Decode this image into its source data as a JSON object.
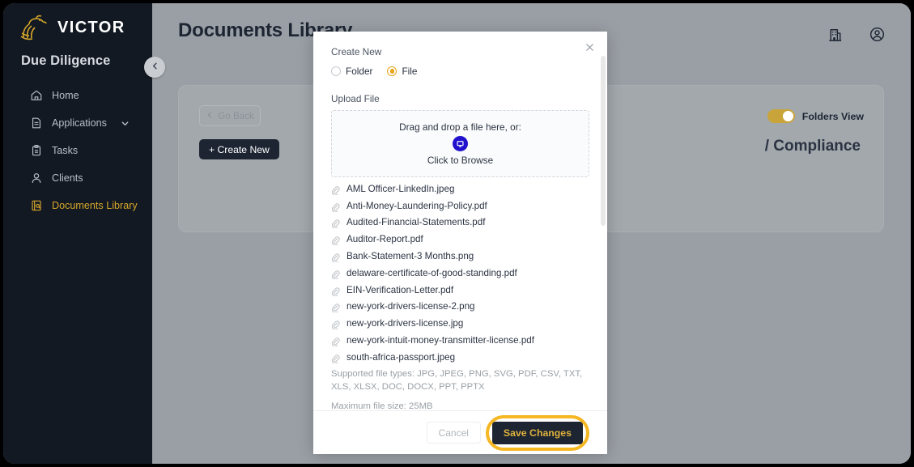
{
  "sidebar": {
    "brand_name": "VICTOR",
    "brand_mark_icon": "victor-lion-logo",
    "app_subtitle": "Due Diligence",
    "collapse_icon": "chevron-left-icon",
    "items": [
      {
        "label": "Home",
        "icon": "home-icon",
        "active": false,
        "caret": false
      },
      {
        "label": "Applications",
        "icon": "document-icon",
        "active": false,
        "caret": true
      },
      {
        "label": "Tasks",
        "icon": "clipboard-icon",
        "active": false,
        "caret": false
      },
      {
        "label": "Clients",
        "icon": "user-icon",
        "active": false,
        "caret": false
      },
      {
        "label": "Documents Library",
        "icon": "document-search-icon",
        "active": true,
        "caret": false
      }
    ]
  },
  "topbar": {
    "page_title": "Documents Library",
    "company_icon": "building-icon",
    "account_icon": "user-circle-icon"
  },
  "content": {
    "go_back_label": "Go Back",
    "go_back_icon": "chevron-left-icon",
    "create_new_label": "+ Create New",
    "folders_view_label": "Folders View",
    "folders_view_enabled": "on",
    "breadcrumb": "/ Compliance"
  },
  "modal": {
    "close_icon": "close-icon",
    "create_new_label": "Create New",
    "radio_options": [
      {
        "label": "Folder",
        "selected": false
      },
      {
        "label": "File",
        "selected": true
      }
    ],
    "upload_label": "Upload File",
    "dropzone": {
      "drag_text": "Drag and drop a file here, or:",
      "browse_text": "Click to Browse",
      "icon": "upload-monitor-icon"
    },
    "files": [
      "AML Officer-LinkedIn.jpeg",
      "Anti-Money-Laundering-Policy.pdf",
      "Audited-Financial-Statements.pdf",
      "Auditor-Report.pdf",
      "Bank-Statement-3 Months.png",
      "delaware-certificate-of-good-standing.pdf",
      "EIN-Verification-Letter.pdf",
      "new-york-drivers-license-2.png",
      "new-york-drivers-license.jpg",
      "new-york-intuit-money-transmitter-license.pdf",
      "south-africa-passport.jpeg"
    ],
    "file_icon": "paperclip-icon",
    "supported_types": "Supported file types: JPG, JPEG, PNG, SVG, PDF, CSV, TXT, XLS, XLSX, DOC, DOCX, PPT, PPTX",
    "max_size": "Maximum file size: 25MB",
    "cancel_label": "Cancel",
    "save_label": "Save Changes"
  },
  "colors": {
    "brand_gold": "#d6a629",
    "accent_gold": "#e8a317",
    "highlight_ring": "#f5b722",
    "dark_navy": "#1d2533",
    "upload_blue": "#2211cc"
  }
}
